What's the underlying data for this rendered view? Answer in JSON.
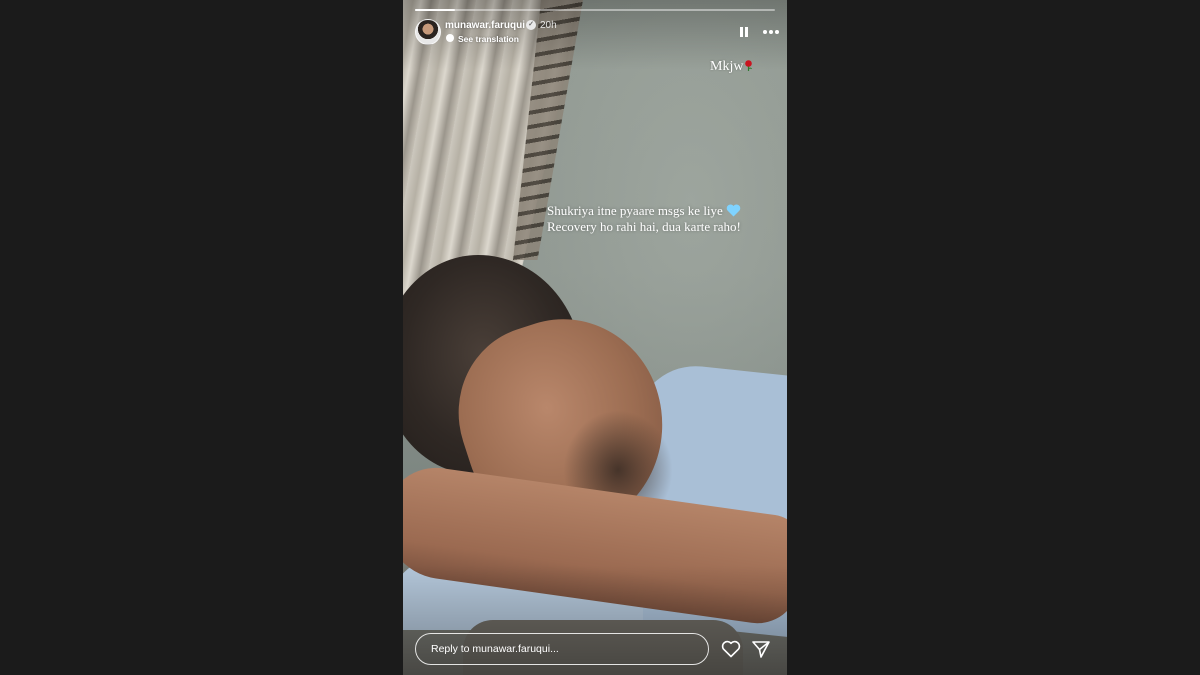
{
  "story": {
    "progress": 0.11,
    "background_color": "#8f9790"
  },
  "header": {
    "username": "munawar.faruqui",
    "verified_icon": "verified-badge-icon",
    "time": "20h",
    "translate_label": "See translation",
    "pause_icon": "pause-icon",
    "more_icon": "more-options-icon"
  },
  "overlay": {
    "sticker_text": "Mkjw",
    "sticker_emoji": "rose-icon",
    "caption_lines": [
      "Shukriya itne pyaare msgs ke liye",
      "Recovery ho rahi hai, dua karte raho!"
    ],
    "caption_emoji": "light-blue-heart-icon",
    "caption_emoji_color": "#7fd3ff"
  },
  "footer": {
    "reply_placeholder": "Reply to munawar.faruqui...",
    "like_icon": "heart-icon",
    "share_icon": "send-icon"
  },
  "colors": {
    "page_background": "#1b1b1b",
    "text": "#ffffff"
  }
}
